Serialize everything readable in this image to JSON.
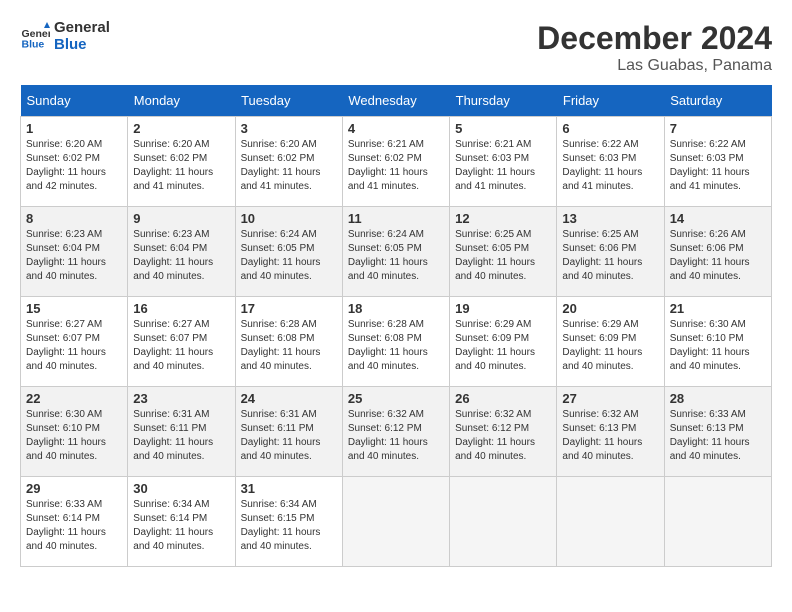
{
  "header": {
    "logo_line1": "General",
    "logo_line2": "Blue",
    "month": "December 2024",
    "location": "Las Guabas, Panama"
  },
  "weekdays": [
    "Sunday",
    "Monday",
    "Tuesday",
    "Wednesday",
    "Thursday",
    "Friday",
    "Saturday"
  ],
  "weeks": [
    [
      {
        "day": "1",
        "sunrise": "6:20 AM",
        "sunset": "6:02 PM",
        "daylight": "11 hours and 42 minutes."
      },
      {
        "day": "2",
        "sunrise": "6:20 AM",
        "sunset": "6:02 PM",
        "daylight": "11 hours and 41 minutes."
      },
      {
        "day": "3",
        "sunrise": "6:20 AM",
        "sunset": "6:02 PM",
        "daylight": "11 hours and 41 minutes."
      },
      {
        "day": "4",
        "sunrise": "6:21 AM",
        "sunset": "6:02 PM",
        "daylight": "11 hours and 41 minutes."
      },
      {
        "day": "5",
        "sunrise": "6:21 AM",
        "sunset": "6:03 PM",
        "daylight": "11 hours and 41 minutes."
      },
      {
        "day": "6",
        "sunrise": "6:22 AM",
        "sunset": "6:03 PM",
        "daylight": "11 hours and 41 minutes."
      },
      {
        "day": "7",
        "sunrise": "6:22 AM",
        "sunset": "6:03 PM",
        "daylight": "11 hours and 41 minutes."
      }
    ],
    [
      {
        "day": "8",
        "sunrise": "6:23 AM",
        "sunset": "6:04 PM",
        "daylight": "11 hours and 40 minutes."
      },
      {
        "day": "9",
        "sunrise": "6:23 AM",
        "sunset": "6:04 PM",
        "daylight": "11 hours and 40 minutes."
      },
      {
        "day": "10",
        "sunrise": "6:24 AM",
        "sunset": "6:05 PM",
        "daylight": "11 hours and 40 minutes."
      },
      {
        "day": "11",
        "sunrise": "6:24 AM",
        "sunset": "6:05 PM",
        "daylight": "11 hours and 40 minutes."
      },
      {
        "day": "12",
        "sunrise": "6:25 AM",
        "sunset": "6:05 PM",
        "daylight": "11 hours and 40 minutes."
      },
      {
        "day": "13",
        "sunrise": "6:25 AM",
        "sunset": "6:06 PM",
        "daylight": "11 hours and 40 minutes."
      },
      {
        "day": "14",
        "sunrise": "6:26 AM",
        "sunset": "6:06 PM",
        "daylight": "11 hours and 40 minutes."
      }
    ],
    [
      {
        "day": "15",
        "sunrise": "6:27 AM",
        "sunset": "6:07 PM",
        "daylight": "11 hours and 40 minutes."
      },
      {
        "day": "16",
        "sunrise": "6:27 AM",
        "sunset": "6:07 PM",
        "daylight": "11 hours and 40 minutes."
      },
      {
        "day": "17",
        "sunrise": "6:28 AM",
        "sunset": "6:08 PM",
        "daylight": "11 hours and 40 minutes."
      },
      {
        "day": "18",
        "sunrise": "6:28 AM",
        "sunset": "6:08 PM",
        "daylight": "11 hours and 40 minutes."
      },
      {
        "day": "19",
        "sunrise": "6:29 AM",
        "sunset": "6:09 PM",
        "daylight": "11 hours and 40 minutes."
      },
      {
        "day": "20",
        "sunrise": "6:29 AM",
        "sunset": "6:09 PM",
        "daylight": "11 hours and 40 minutes."
      },
      {
        "day": "21",
        "sunrise": "6:30 AM",
        "sunset": "6:10 PM",
        "daylight": "11 hours and 40 minutes."
      }
    ],
    [
      {
        "day": "22",
        "sunrise": "6:30 AM",
        "sunset": "6:10 PM",
        "daylight": "11 hours and 40 minutes."
      },
      {
        "day": "23",
        "sunrise": "6:31 AM",
        "sunset": "6:11 PM",
        "daylight": "11 hours and 40 minutes."
      },
      {
        "day": "24",
        "sunrise": "6:31 AM",
        "sunset": "6:11 PM",
        "daylight": "11 hours and 40 minutes."
      },
      {
        "day": "25",
        "sunrise": "6:32 AM",
        "sunset": "6:12 PM",
        "daylight": "11 hours and 40 minutes."
      },
      {
        "day": "26",
        "sunrise": "6:32 AM",
        "sunset": "6:12 PM",
        "daylight": "11 hours and 40 minutes."
      },
      {
        "day": "27",
        "sunrise": "6:32 AM",
        "sunset": "6:13 PM",
        "daylight": "11 hours and 40 minutes."
      },
      {
        "day": "28",
        "sunrise": "6:33 AM",
        "sunset": "6:13 PM",
        "daylight": "11 hours and 40 minutes."
      }
    ],
    [
      {
        "day": "29",
        "sunrise": "6:33 AM",
        "sunset": "6:14 PM",
        "daylight": "11 hours and 40 minutes."
      },
      {
        "day": "30",
        "sunrise": "6:34 AM",
        "sunset": "6:14 PM",
        "daylight": "11 hours and 40 minutes."
      },
      {
        "day": "31",
        "sunrise": "6:34 AM",
        "sunset": "6:15 PM",
        "daylight": "11 hours and 40 minutes."
      },
      null,
      null,
      null,
      null
    ]
  ]
}
